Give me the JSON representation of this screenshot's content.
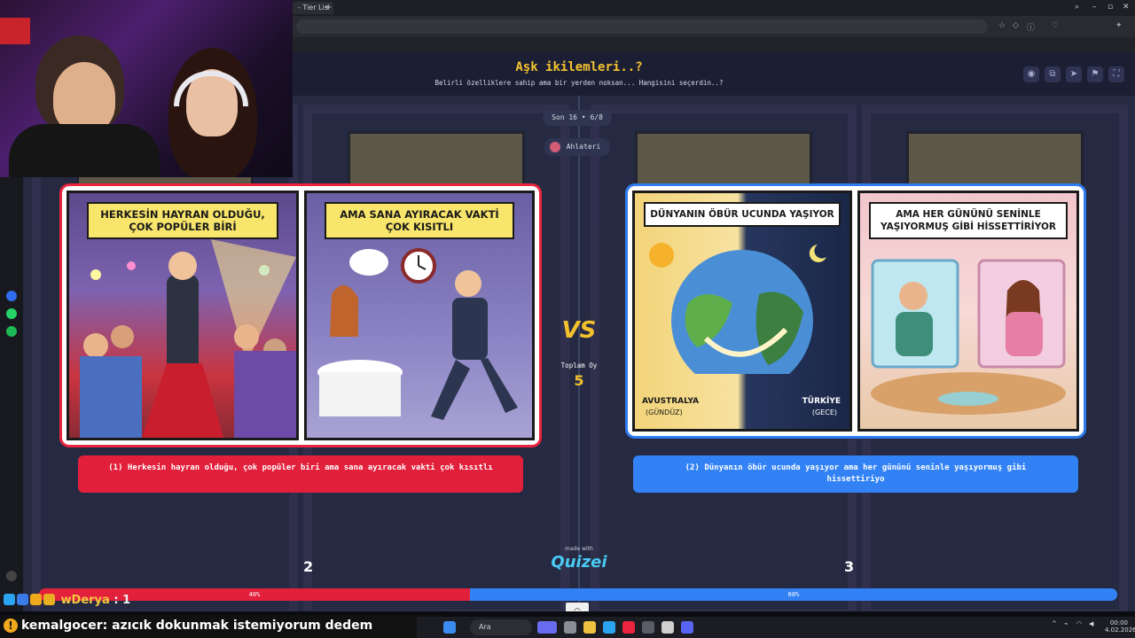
{
  "browser": {
    "tab_label": "- Tier Lis",
    "new_tab": "+"
  },
  "app": {
    "title": "Aşk ikilemleri..?",
    "subtitle": "Belirli özelliklere sahip ama bir yerden noksan... Hangisini seçerdin..?",
    "round_label": "Son 16 • 6/8",
    "user_label": "Ahlateri",
    "vs_label": "VS",
    "total_votes_label": "Toplam Oy",
    "total_votes_value": "5",
    "made_with": "made with",
    "brand": "Quizei"
  },
  "option1": {
    "panel1_caption": "HERKESİN HAYRAN OLDUĞU, ÇOK POPÜLER BİRİ",
    "panel2_caption": "AMA SANA AYIRACAK VAKTİ ÇOK KISITLI",
    "button_text": "(1) Herkesin hayran olduğu, çok popüler biri ama sana ayıracak vakti çok kısıtlı",
    "count": "2",
    "percent": "40%",
    "percent_value": 40
  },
  "option2": {
    "panel1_caption": "DÜNYANIN ÖBÜR UCUNDA YAŞIYOR",
    "panel1_label_left": "AVUSTRALYA",
    "panel1_label_left_sub": "(GÜNDÜZ)",
    "panel1_label_right": "TÜRKİYE",
    "panel1_label_right_sub": "(GECE)",
    "panel2_caption": "AMA HER GÜNÜNÜ SENİNLE YAŞIYORMUŞ GİBİ HİSSETTİRİYOR",
    "button_text": "(2) Dünyanın öbür ucunda yaşıyor ama her gününü seninle yaşıyormuş gibi hissettiriyo",
    "count": "3",
    "percent": "60%",
    "percent_value": 60
  },
  "stream": {
    "chat_name": "wDerya",
    "chat_count": ": 1",
    "bottom_user": "kemalgocer",
    "bottom_message": ": azıcık dokunmak istemiyorum dedem"
  },
  "taskbar": {
    "search_label": "Ara",
    "time": "00:00",
    "date": "4.02.2026"
  },
  "colors": {
    "option1": "#e3203b",
    "option2": "#3282f6",
    "title": "#f4c430",
    "app_bg": "#252a42"
  }
}
